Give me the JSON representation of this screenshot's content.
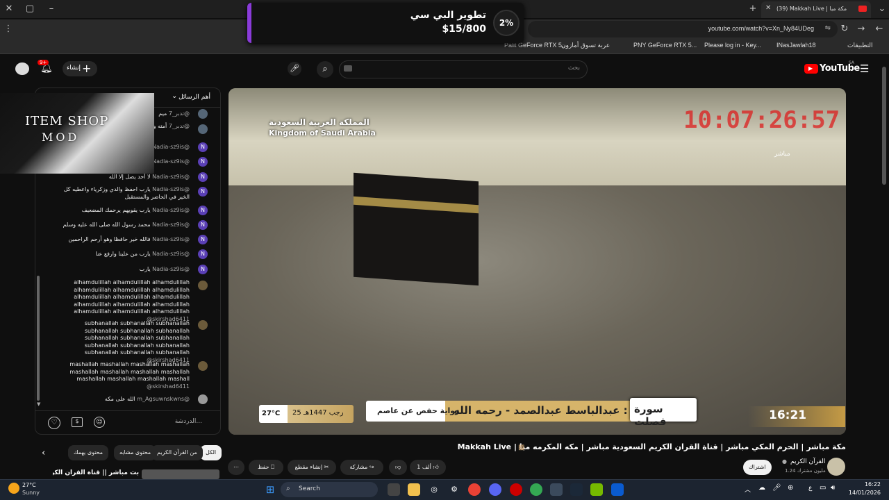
{
  "browser": {
    "tab_title": "(39) Makkah Live | مكة مبا",
    "url": "youtube.com/watch?v=Xn_Ny84UDeg",
    "bookmarks": [
      "Palit GeForce RTX 5...",
      "عربة تسوق أمازون",
      "PNY GeForce RTX 5...",
      "Please log in - Key...",
      "INasJawlah18",
      "التطبيقات"
    ]
  },
  "donation": {
    "title": "تطوير البي سي",
    "progress_label": "$15/800",
    "percent_label": "2%",
    "percent": 2
  },
  "youtube": {
    "logo": "YouTube",
    "region": "SA",
    "search_placeholder": "بحث",
    "create_label": "إنشاء",
    "notif_count": "9+"
  },
  "chat": {
    "header": "أهم الرسائل",
    "messages": [
      {
        "author": "@تدبر_7",
        "text": "ميم"
      },
      {
        "author": "@تدبر_7",
        "text": "أمته والسلمات والعلوه"
      },
      {
        "author": "@Nadia-sz9is",
        "text": ""
      },
      {
        "author": "@Nadia-sz9is",
        "text": ""
      },
      {
        "author": "@Nadia-sz9is",
        "text": "لا أحد يصل إلا الله"
      },
      {
        "author": "@Nadia-sz9is",
        "text": "يارب احفظ والدي وزكرياء واعطيه كل الخير في الحاضر والمستقبل"
      },
      {
        "author": "@Nadia-sz9is",
        "text": "يارب يقويهم يرحمك المضعيف"
      },
      {
        "author": "@Nadia-sz9is",
        "text": "محمد رسول الله صلى الله عليه وسلم"
      },
      {
        "author": "@Nadia-sz9is",
        "text": "فالله خير حافظا وهو أرحم الراحمين"
      },
      {
        "author": "@Nadia-sz9is",
        "text": "يارب من علينا وارفع عنا"
      },
      {
        "author": "@Nadia-sz9is",
        "text": "يارب"
      },
      {
        "author": "@skirshad6411",
        "text": "alhamdulillah alhamdulillah alhamdulillah alhamdulillah alhamdulillah alhamdulillah alhamdulillah alhamdulillah alhamdulillah alhamdulillah alhamdulillah alhamdulillah alhamdulillah alhamdulillah alhamdulillah"
      },
      {
        "author": "@skirshad6411",
        "text": "subhanallah subhanallah subhanallah subhanallah subhanallah subhanallah subhanallah subhanallah subhanallah subhanallah subhanallah subhanallah subhanallah subhanallah subhanallah"
      },
      {
        "author": "@skirshad6411",
        "text": "mashallah mashallah mashallah mashallah mashallah mashallah mashallah mashallah mashallah mashallah mashallah mashall"
      },
      {
        "author": "@m_Agsuwnskwns",
        "text": "الله على مكه"
      }
    ],
    "input_placeholder": "الدردشة...",
    "overlay_title": "ITEM SHOP",
    "overlay_sub": "MOD"
  },
  "video": {
    "channel_tag": "المملكة العربية السعودية",
    "channel_tag_en": "Kingdom of Saudi Arabia",
    "clock": "10:07:26:57",
    "live_label": "مباشر",
    "surah": "سورة فصلت",
    "reader": "القارئ : عبدالباسط عبدالصمد - رحمه الله",
    "riwaya": "رواية حفص عن عاصم",
    "date": "25 رجب 1447هـ",
    "temp": "27°C",
    "time": "16:21"
  },
  "below": {
    "title": "مكة مباشر | الحرم المكي مباشر | قناة القران الكريم السعودية مباشر | مكه المكرمه مبا | Makkah Live",
    "channel": "القرآن الكريم",
    "subs": "1.24 مليون مشترك",
    "subscribe": "اشتراك",
    "likes": "1 ألف",
    "share": "مشاركة",
    "clip": "إنشاء مقطع",
    "save": "حفظ"
  },
  "chips": [
    "الكل",
    "من القرآن الكريم",
    "محتوى مشابه",
    "محتوى يهمك"
  ],
  "related": "بث مباشر || قناة القرآن الكريم Makkah",
  "weather": {
    "temp": "27°C",
    "desc": "Sunny"
  },
  "taskbar": {
    "search": "Search",
    "time": "16:22",
    "date": "14/01/2026"
  }
}
